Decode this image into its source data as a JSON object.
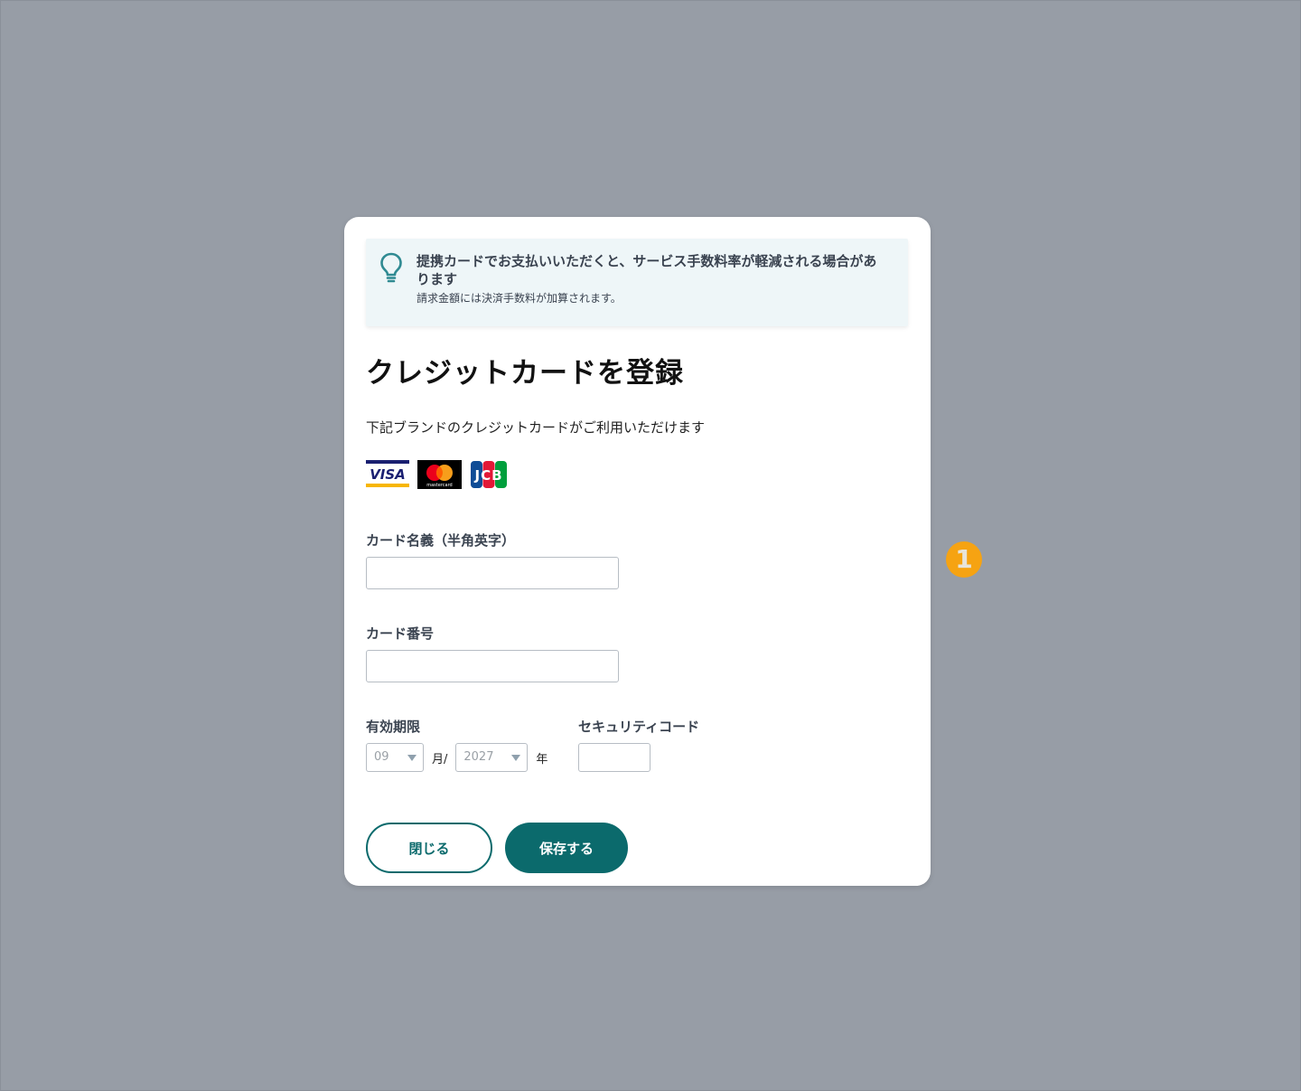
{
  "notice": {
    "icon": "lightbulb-icon",
    "title": "提携カードでお支払いいただくと、サービス手数料率が軽減される場合があります",
    "subtitle": "請求金額には決済手数料が加算されます。"
  },
  "dialog": {
    "title": "クレジットカードを登録",
    "lead": "下記ブランドのクレジットカードがご利用いただけます",
    "brands": [
      "VISA",
      "mastercard",
      "JCB"
    ]
  },
  "form": {
    "card_name_label": "カード名義（半角英字）",
    "card_number_label": "カード番号",
    "expiry_label": "有効期限",
    "expiry_month": "09",
    "month_unit": "月/",
    "expiry_year": "2027",
    "year_unit": "年",
    "cvc_label": "セキュリティコード"
  },
  "buttons": {
    "close_label": "閉じる",
    "save_label": "保存する"
  },
  "marker": {
    "number": "1"
  },
  "colors": {
    "accent": "#0b6a6c",
    "overlay": "#979da6",
    "notice_bg": "#eef6f8",
    "marker": "#f6a312"
  }
}
